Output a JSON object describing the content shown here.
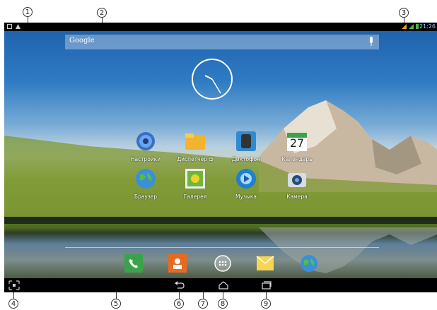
{
  "callouts": [
    "1",
    "2",
    "3",
    "4",
    "5",
    "6",
    "7",
    "8",
    "9"
  ],
  "search": {
    "label": "Google"
  },
  "status": {
    "time": "21:26"
  },
  "apps": [
    {
      "label": "Настройки",
      "icon": "settings-icon"
    },
    {
      "label": "Диспетчер ф",
      "icon": "folder-icon"
    },
    {
      "label": "Диктофон",
      "icon": "recorder-icon"
    },
    {
      "label": "Календарь",
      "icon": "calendar-icon",
      "badge": "27"
    },
    {
      "label": "Браузер",
      "icon": "globe-icon"
    },
    {
      "label": "Галерея",
      "icon": "gallery-icon"
    },
    {
      "label": "Музыка",
      "icon": "music-icon"
    },
    {
      "label": "Камера",
      "icon": "camera-icon"
    }
  ],
  "dock": [
    {
      "icon": "phone-icon"
    },
    {
      "icon": "contacts-icon"
    },
    {
      "icon": "all-apps-icon"
    },
    {
      "icon": "messaging-icon"
    },
    {
      "icon": "browser-icon"
    }
  ],
  "nav": [
    {
      "icon": "screenshot-icon"
    },
    {
      "icon": "back-icon"
    },
    {
      "icon": "home-icon"
    },
    {
      "icon": "recent-apps-icon"
    }
  ]
}
